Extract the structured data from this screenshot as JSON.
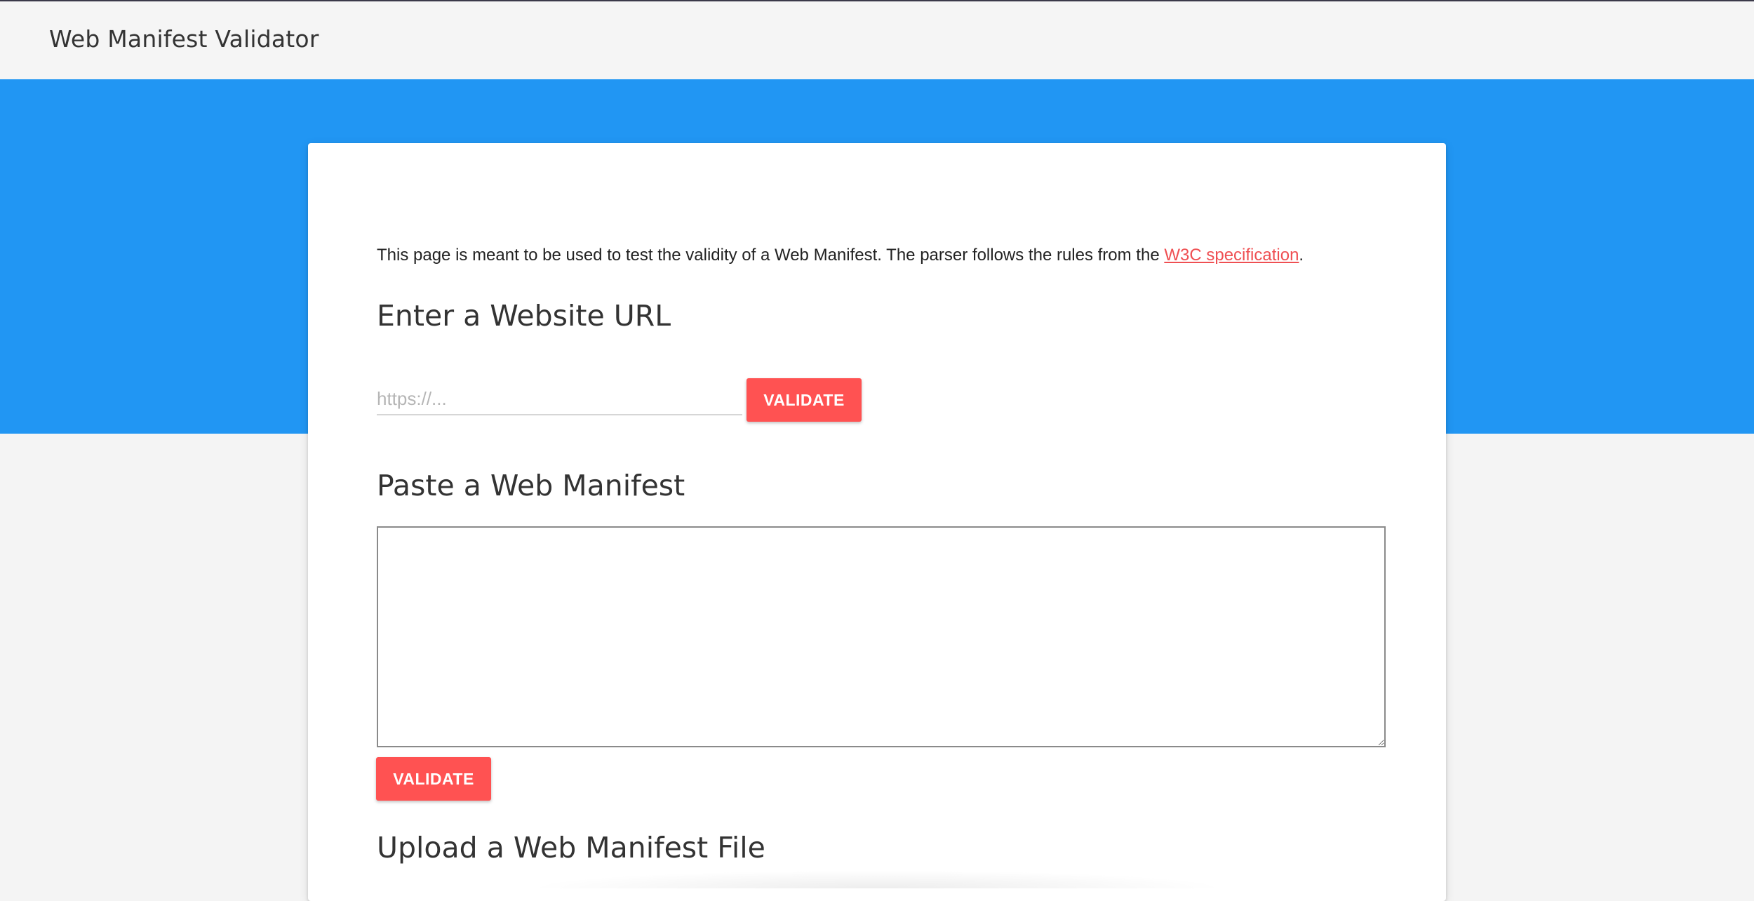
{
  "app": {
    "title": "Web Manifest Validator"
  },
  "intro": {
    "text_before": "This page is meant to be used to test the validity of a Web Manifest. The parser follows the rules from the ",
    "link_text": "W3C specification",
    "text_after": "."
  },
  "url_section": {
    "heading": "Enter a Website URL",
    "input_value": "",
    "input_placeholder": "https://...",
    "button_label": "VALIDATE"
  },
  "paste_section": {
    "heading": "Paste a Web Manifest",
    "textarea_value": "",
    "button_label": "VALIDATE"
  },
  "upload_section": {
    "heading": "Upload a Web Manifest File"
  },
  "colors": {
    "hero": "#2196f3",
    "button": "#ff5252",
    "link": "#ef4f52",
    "appbar": "#f5f5f5",
    "page_background": "#f4f4f4"
  }
}
